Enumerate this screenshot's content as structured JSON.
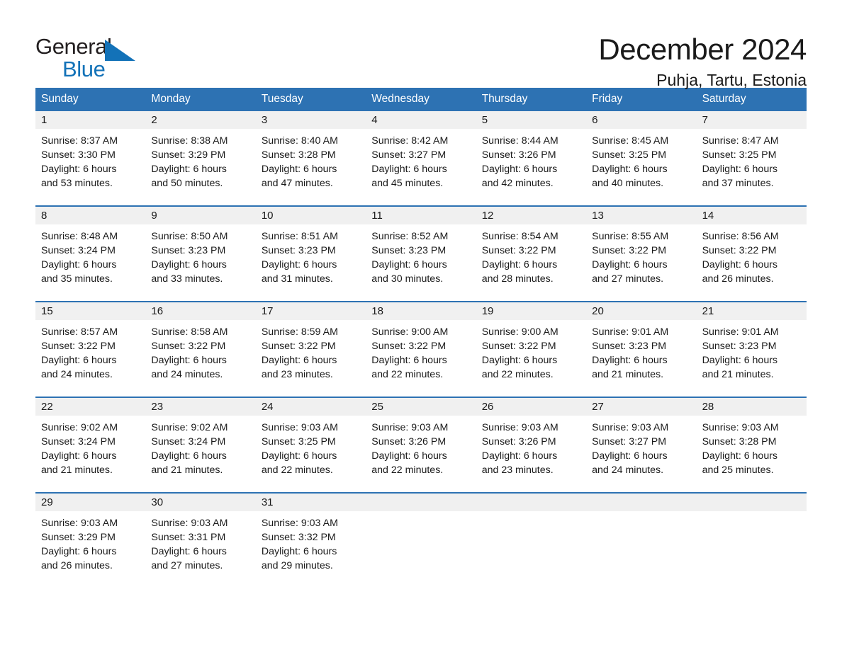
{
  "brand": {
    "name_part1": "General",
    "name_part2": "Blue",
    "accent_color": "#1372b8",
    "triangle_icon": "brand-triangle-icon"
  },
  "header": {
    "title": "December 2024",
    "location": "Puhja, Tartu, Estonia"
  },
  "calendar": {
    "header_bg": "#2d72b3",
    "daynum_bg": "#f0f0f0",
    "weekdays": [
      "Sunday",
      "Monday",
      "Tuesday",
      "Wednesday",
      "Thursday",
      "Friday",
      "Saturday"
    ],
    "weeks": [
      [
        {
          "day": "1",
          "sunrise": "Sunrise: 8:37 AM",
          "sunset": "Sunset: 3:30 PM",
          "daylight1": "Daylight: 6 hours",
          "daylight2": "and 53 minutes."
        },
        {
          "day": "2",
          "sunrise": "Sunrise: 8:38 AM",
          "sunset": "Sunset: 3:29 PM",
          "daylight1": "Daylight: 6 hours",
          "daylight2": "and 50 minutes."
        },
        {
          "day": "3",
          "sunrise": "Sunrise: 8:40 AM",
          "sunset": "Sunset: 3:28 PM",
          "daylight1": "Daylight: 6 hours",
          "daylight2": "and 47 minutes."
        },
        {
          "day": "4",
          "sunrise": "Sunrise: 8:42 AM",
          "sunset": "Sunset: 3:27 PM",
          "daylight1": "Daylight: 6 hours",
          "daylight2": "and 45 minutes."
        },
        {
          "day": "5",
          "sunrise": "Sunrise: 8:44 AM",
          "sunset": "Sunset: 3:26 PM",
          "daylight1": "Daylight: 6 hours",
          "daylight2": "and 42 minutes."
        },
        {
          "day": "6",
          "sunrise": "Sunrise: 8:45 AM",
          "sunset": "Sunset: 3:25 PM",
          "daylight1": "Daylight: 6 hours",
          "daylight2": "and 40 minutes."
        },
        {
          "day": "7",
          "sunrise": "Sunrise: 8:47 AM",
          "sunset": "Sunset: 3:25 PM",
          "daylight1": "Daylight: 6 hours",
          "daylight2": "and 37 minutes."
        }
      ],
      [
        {
          "day": "8",
          "sunrise": "Sunrise: 8:48 AM",
          "sunset": "Sunset: 3:24 PM",
          "daylight1": "Daylight: 6 hours",
          "daylight2": "and 35 minutes."
        },
        {
          "day": "9",
          "sunrise": "Sunrise: 8:50 AM",
          "sunset": "Sunset: 3:23 PM",
          "daylight1": "Daylight: 6 hours",
          "daylight2": "and 33 minutes."
        },
        {
          "day": "10",
          "sunrise": "Sunrise: 8:51 AM",
          "sunset": "Sunset: 3:23 PM",
          "daylight1": "Daylight: 6 hours",
          "daylight2": "and 31 minutes."
        },
        {
          "day": "11",
          "sunrise": "Sunrise: 8:52 AM",
          "sunset": "Sunset: 3:23 PM",
          "daylight1": "Daylight: 6 hours",
          "daylight2": "and 30 minutes."
        },
        {
          "day": "12",
          "sunrise": "Sunrise: 8:54 AM",
          "sunset": "Sunset: 3:22 PM",
          "daylight1": "Daylight: 6 hours",
          "daylight2": "and 28 minutes."
        },
        {
          "day": "13",
          "sunrise": "Sunrise: 8:55 AM",
          "sunset": "Sunset: 3:22 PM",
          "daylight1": "Daylight: 6 hours",
          "daylight2": "and 27 minutes."
        },
        {
          "day": "14",
          "sunrise": "Sunrise: 8:56 AM",
          "sunset": "Sunset: 3:22 PM",
          "daylight1": "Daylight: 6 hours",
          "daylight2": "and 26 minutes."
        }
      ],
      [
        {
          "day": "15",
          "sunrise": "Sunrise: 8:57 AM",
          "sunset": "Sunset: 3:22 PM",
          "daylight1": "Daylight: 6 hours",
          "daylight2": "and 24 minutes."
        },
        {
          "day": "16",
          "sunrise": "Sunrise: 8:58 AM",
          "sunset": "Sunset: 3:22 PM",
          "daylight1": "Daylight: 6 hours",
          "daylight2": "and 24 minutes."
        },
        {
          "day": "17",
          "sunrise": "Sunrise: 8:59 AM",
          "sunset": "Sunset: 3:22 PM",
          "daylight1": "Daylight: 6 hours",
          "daylight2": "and 23 minutes."
        },
        {
          "day": "18",
          "sunrise": "Sunrise: 9:00 AM",
          "sunset": "Sunset: 3:22 PM",
          "daylight1": "Daylight: 6 hours",
          "daylight2": "and 22 minutes."
        },
        {
          "day": "19",
          "sunrise": "Sunrise: 9:00 AM",
          "sunset": "Sunset: 3:22 PM",
          "daylight1": "Daylight: 6 hours",
          "daylight2": "and 22 minutes."
        },
        {
          "day": "20",
          "sunrise": "Sunrise: 9:01 AM",
          "sunset": "Sunset: 3:23 PM",
          "daylight1": "Daylight: 6 hours",
          "daylight2": "and 21 minutes."
        },
        {
          "day": "21",
          "sunrise": "Sunrise: 9:01 AM",
          "sunset": "Sunset: 3:23 PM",
          "daylight1": "Daylight: 6 hours",
          "daylight2": "and 21 minutes."
        }
      ],
      [
        {
          "day": "22",
          "sunrise": "Sunrise: 9:02 AM",
          "sunset": "Sunset: 3:24 PM",
          "daylight1": "Daylight: 6 hours",
          "daylight2": "and 21 minutes."
        },
        {
          "day": "23",
          "sunrise": "Sunrise: 9:02 AM",
          "sunset": "Sunset: 3:24 PM",
          "daylight1": "Daylight: 6 hours",
          "daylight2": "and 21 minutes."
        },
        {
          "day": "24",
          "sunrise": "Sunrise: 9:03 AM",
          "sunset": "Sunset: 3:25 PM",
          "daylight1": "Daylight: 6 hours",
          "daylight2": "and 22 minutes."
        },
        {
          "day": "25",
          "sunrise": "Sunrise: 9:03 AM",
          "sunset": "Sunset: 3:26 PM",
          "daylight1": "Daylight: 6 hours",
          "daylight2": "and 22 minutes."
        },
        {
          "day": "26",
          "sunrise": "Sunrise: 9:03 AM",
          "sunset": "Sunset: 3:26 PM",
          "daylight1": "Daylight: 6 hours",
          "daylight2": "and 23 minutes."
        },
        {
          "day": "27",
          "sunrise": "Sunrise: 9:03 AM",
          "sunset": "Sunset: 3:27 PM",
          "daylight1": "Daylight: 6 hours",
          "daylight2": "and 24 minutes."
        },
        {
          "day": "28",
          "sunrise": "Sunrise: 9:03 AM",
          "sunset": "Sunset: 3:28 PM",
          "daylight1": "Daylight: 6 hours",
          "daylight2": "and 25 minutes."
        }
      ],
      [
        {
          "day": "29",
          "sunrise": "Sunrise: 9:03 AM",
          "sunset": "Sunset: 3:29 PM",
          "daylight1": "Daylight: 6 hours",
          "daylight2": "and 26 minutes."
        },
        {
          "day": "30",
          "sunrise": "Sunrise: 9:03 AM",
          "sunset": "Sunset: 3:31 PM",
          "daylight1": "Daylight: 6 hours",
          "daylight2": "and 27 minutes."
        },
        {
          "day": "31",
          "sunrise": "Sunrise: 9:03 AM",
          "sunset": "Sunset: 3:32 PM",
          "daylight1": "Daylight: 6 hours",
          "daylight2": "and 29 minutes."
        },
        {
          "day": "",
          "sunrise": "",
          "sunset": "",
          "daylight1": "",
          "daylight2": ""
        },
        {
          "day": "",
          "sunrise": "",
          "sunset": "",
          "daylight1": "",
          "daylight2": ""
        },
        {
          "day": "",
          "sunrise": "",
          "sunset": "",
          "daylight1": "",
          "daylight2": ""
        },
        {
          "day": "",
          "sunrise": "",
          "sunset": "",
          "daylight1": "",
          "daylight2": ""
        }
      ]
    ]
  }
}
